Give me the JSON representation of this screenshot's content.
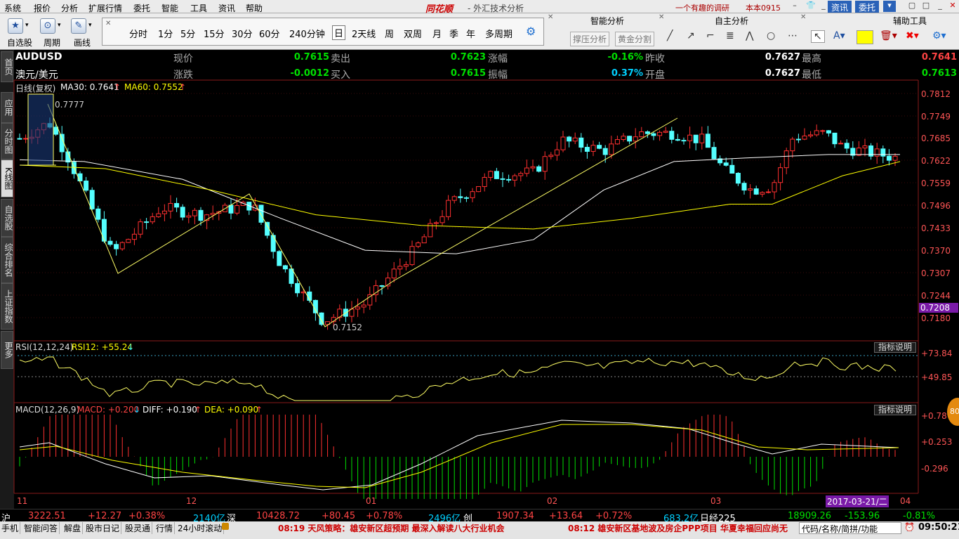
{
  "menu": {
    "items": [
      "系统",
      "报价",
      "分析",
      "扩展行情",
      "委托",
      "智能",
      "工具",
      "资讯",
      "帮助"
    ],
    "brand": "同花顺",
    "subtitle": "- 外汇技术分析",
    "marquee": "一个有趣的调研",
    "user": "本本0915",
    "right_buttons": [
      "资讯",
      "委托"
    ]
  },
  "toolbar": {
    "tools": [
      {
        "label": "自选股",
        "icon": "star-icon"
      },
      {
        "label": "周期",
        "icon": "period-icon"
      },
      {
        "label": "画线",
        "icon": "pen-icon"
      }
    ],
    "periods": [
      "分时",
      "1分",
      "5分",
      "15分",
      "30分",
      "60分",
      "240分钟",
      "日",
      "2天线",
      "周",
      "双周",
      "月",
      "季",
      "年",
      "多周期"
    ],
    "active_period": "日",
    "sections": {
      "smart": "智能分析",
      "self": "自主分析",
      "aux": "辅助工具"
    },
    "smart_buttons": [
      "撑压分析",
      "黄金分割"
    ]
  },
  "sidebar": {
    "tabs": [
      "首页",
      "应用",
      "分时图",
      "K线图",
      "自选股",
      "综合排名",
      "上证指数",
      "更多"
    ]
  },
  "quote": {
    "symbol": "AUDUSD",
    "name": "澳元/美元",
    "row1": [
      {
        "label": "现价",
        "value": "0.7615"
      },
      {
        "label": "卖出",
        "value": "0.7623"
      },
      {
        "label": "涨幅",
        "value": "-0.16%"
      },
      {
        "label": "昨收",
        "value": "0.7627"
      },
      {
        "label": "最高",
        "value": "0.7641"
      }
    ],
    "row2": [
      {
        "label": "涨跌",
        "value": "-0.0012"
      },
      {
        "label": "买入",
        "value": "0.7615"
      },
      {
        "label": "振幅",
        "value": "0.37%"
      },
      {
        "label": "开盘",
        "value": "0.7627"
      },
      {
        "label": "最低",
        "value": "0.7613"
      }
    ]
  },
  "main": {
    "title": "日线(复权)",
    "ma30": "MA30: 0.7641",
    "ma60": "MA60: 0.7552",
    "high_mark": "0.7777",
    "low_mark": "0.7152",
    "y_axis": [
      "0.7812",
      "0.7749",
      "0.7685",
      "0.7622",
      "0.7559",
      "0.7496",
      "0.7433",
      "0.7370",
      "0.7307",
      "0.7244",
      "0.7180"
    ],
    "current_price_tag": "0.7208"
  },
  "rsi": {
    "title": "RSI(12,12,24)",
    "value": "RSI12: +55.24",
    "help": "指标说明",
    "y_axis": [
      "+73.84",
      "+49.85"
    ],
    "levels": [
      73.84,
      49.85
    ]
  },
  "macd": {
    "title": "MACD(12,26,9)",
    "macd": "MACD: +0.200",
    "diff": "DIFF: +0.190",
    "dea": "DEA: +0.090",
    "help": "指标说明",
    "y_axis": [
      "+0.787",
      "+0.253",
      "-0.296"
    ]
  },
  "x_axis": {
    "labels": [
      "11",
      "12",
      "01",
      "02",
      "03",
      "04"
    ],
    "cursor_date": "2017-03-21/二"
  },
  "status1": {
    "sh_label": "沪",
    "sh_index": "3222.51",
    "sh_change": "+12.27",
    "sh_pct": "+0.38%",
    "sh_vol": "2140亿",
    "sz_label": "深",
    "sz_index": "10428.72",
    "sz_change": "+80.45",
    "sz_pct": "+0.78%",
    "sz_vol": "2496亿",
    "cy_label": "创",
    "cy_index": "1907.34",
    "cy_change": "+13.64",
    "cy_pct": "+0.72%",
    "cy_vol": "683.2亿",
    "rj_label": "日经225",
    "rj_index": "18909.26",
    "rj_change": "-153.96",
    "rj_pct": "-0.81%"
  },
  "status2": {
    "tabs": [
      "手机",
      "智能问答",
      "解盘",
      "股市日记",
      "股灵通",
      "行情",
      "24小时滚动"
    ],
    "news1": "08:19 天风策略：雄安新区超预期 最深入解读八大行业机会",
    "news2": "08:12 雄安新区基地波及房企PPP项目 华夏幸福回应尚无",
    "search": "代码/名称/简拼/功能",
    "time": "09:50:21"
  },
  "badge": "80"
}
